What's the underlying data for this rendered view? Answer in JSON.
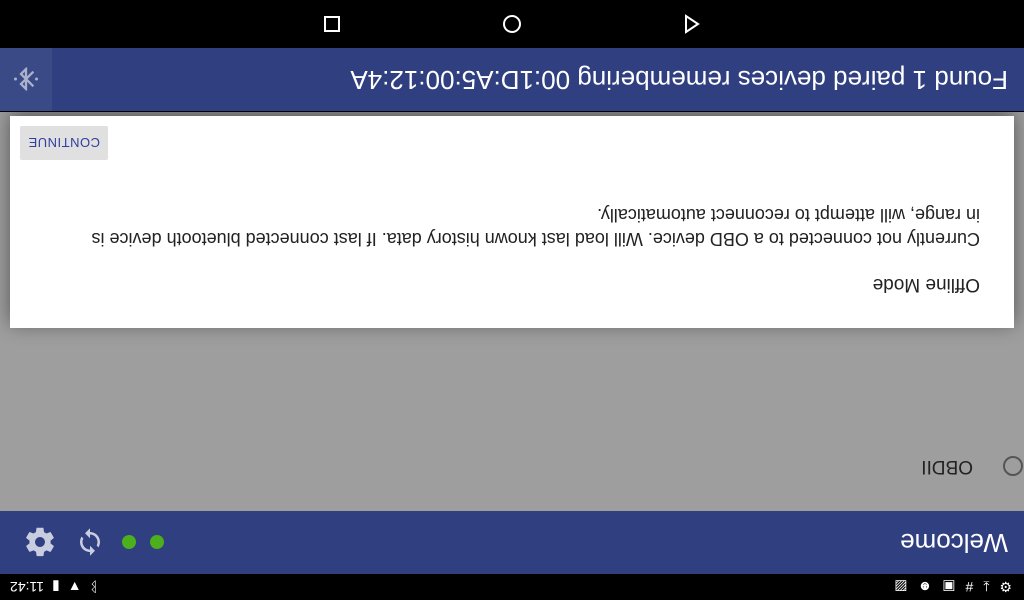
{
  "status_bar": {
    "time": "11:42",
    "left_icons": [
      "settings-icon",
      "download-icon",
      "hash-icon",
      "screenshot-icon",
      "android-icon",
      "image-icon"
    ],
    "right_icons": [
      "bluetooth-icon",
      "wifi-icon",
      "battery-icon"
    ]
  },
  "app_bar": {
    "title": "Welcome"
  },
  "device_list": {
    "items": [
      {
        "label": "OBDII",
        "selected": false
      }
    ]
  },
  "dialog": {
    "title": "Offline Mode",
    "message": "Currently not connected to a OBD device. Will load last known history data. If last connected bluetooth device is in range, will attempt to reconnect automatically.",
    "button_label": "CONTINUE"
  },
  "bottom_status": {
    "text": "Found 1 paired devices remembering 00:1D:A5:00:12:4A"
  },
  "colors": {
    "primary": "#303f7f",
    "accent": "#303f9f",
    "status_dot": "#4caf1c"
  }
}
